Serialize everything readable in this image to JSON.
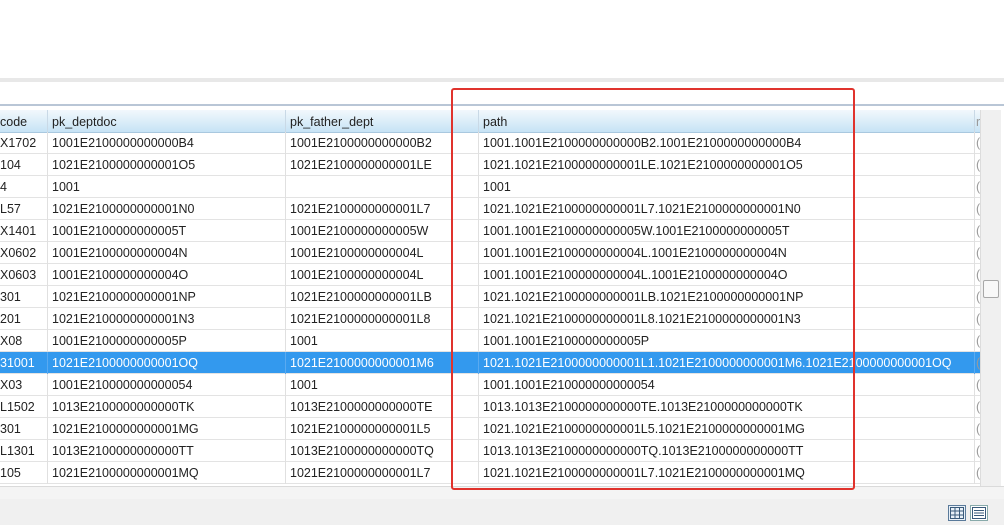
{
  "grid": {
    "columns": [
      {
        "key": "code",
        "label": "code"
      },
      {
        "key": "pk_deptdoc",
        "label": "pk_deptdoc"
      },
      {
        "key": "pk_father_dept",
        "label": "pk_father_dept"
      },
      {
        "key": "path",
        "label": "path"
      },
      {
        "key": "next",
        "label": "r"
      }
    ],
    "rows": [
      {
        "code": "X1702",
        "pk_deptdoc": "1001E2100000000000B4",
        "pk_father_dept": "1001E2100000000000B2",
        "path": "1001.1001E2100000000000B2.1001E2100000000000B4",
        "next": "("
      },
      {
        "code": "104",
        "pk_deptdoc": "1021E2100000000001O5",
        "pk_father_dept": "1021E2100000000001LE",
        "path": "1021.1021E2100000000001LE.1021E2100000000001O5",
        "next": "("
      },
      {
        "code": "4",
        "pk_deptdoc": "1001",
        "pk_father_dept": "",
        "path": "1001",
        "next": "("
      },
      {
        "code": "L57",
        "pk_deptdoc": "1021E2100000000001N0",
        "pk_father_dept": "1021E2100000000001L7",
        "path": "1021.1021E2100000000001L7.1021E2100000000001N0",
        "next": "("
      },
      {
        "code": "X1401",
        "pk_deptdoc": "1001E2100000000005T",
        "pk_father_dept": "1001E2100000000005W",
        "path": "1001.1001E2100000000005W.1001E2100000000005T",
        "next": "("
      },
      {
        "code": "X0602",
        "pk_deptdoc": "1001E2100000000004N",
        "pk_father_dept": "1001E2100000000004L",
        "path": "1001.1001E2100000000004L.1001E2100000000004N",
        "next": "("
      },
      {
        "code": "X0603",
        "pk_deptdoc": "1001E2100000000004O",
        "pk_father_dept": "1001E2100000000004L",
        "path": "1001.1001E2100000000004L.1001E2100000000004O",
        "next": "("
      },
      {
        "code": "301",
        "pk_deptdoc": "1021E2100000000001NP",
        "pk_father_dept": "1021E2100000000001LB",
        "path": "1021.1021E2100000000001LB.1021E2100000000001NP",
        "next": "("
      },
      {
        "code": "201",
        "pk_deptdoc": "1021E2100000000001N3",
        "pk_father_dept": "1021E2100000000001L8",
        "path": "1021.1021E2100000000001L8.1021E2100000000001N3",
        "next": "("
      },
      {
        "code": "X08",
        "pk_deptdoc": "1001E2100000000005P",
        "pk_father_dept": "1001",
        "path": "1001.1001E2100000000005P",
        "next": "("
      },
      {
        "code": "31001",
        "pk_deptdoc": "1021E2100000000001OQ",
        "pk_father_dept": "1021E2100000000001M6",
        "path": "1021.1021E2100000000001L1.1021E2100000000001M6.1021E2100000000001OQ",
        "next": "(",
        "selected": true
      },
      {
        "code": "X03",
        "pk_deptdoc": "1001E210000000000054",
        "pk_father_dept": "1001",
        "path": "1001.1001E210000000000054",
        "next": "("
      },
      {
        "code": "L1502",
        "pk_deptdoc": "1013E2100000000000TK",
        "pk_father_dept": "1013E2100000000000TE",
        "path": "1013.1013E2100000000000TE.1013E2100000000000TK",
        "next": "("
      },
      {
        "code": "301",
        "pk_deptdoc": "1021E2100000000001MG",
        "pk_father_dept": "1021E2100000000001L5",
        "path": "1021.1021E2100000000001L5.1021E2100000000001MG",
        "next": "("
      },
      {
        "code": "L1301",
        "pk_deptdoc": "1013E2100000000000TT",
        "pk_father_dept": "1013E2100000000000TQ",
        "path": "1013.1013E2100000000000TQ.1013E2100000000000TT",
        "next": "("
      },
      {
        "code": "105",
        "pk_deptdoc": "1021E2100000000001MQ",
        "pk_father_dept": "1021E2100000000001L7",
        "path": "1021.1021E2100000000001L7.1021E2100000000001MQ",
        "next": "("
      }
    ]
  },
  "footer": {
    "views": [
      {
        "name": "grid-view",
        "icon": "grid-icon",
        "active": true
      },
      {
        "name": "list-view",
        "icon": "list-icon",
        "active": false
      }
    ]
  },
  "colors": {
    "selection": "#3399ee",
    "highlight_box": "#e0332d",
    "header_gradient_bottom": "#c6e3f5"
  }
}
